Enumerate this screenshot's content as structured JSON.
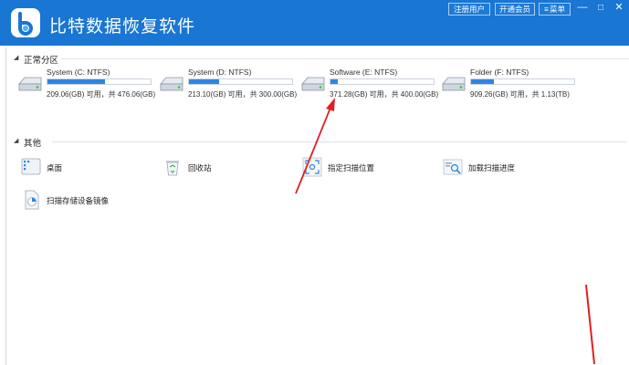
{
  "app": {
    "title": "比特数据恢复软件"
  },
  "header": {
    "register_label": "注册用户",
    "vip_label": "开通会员",
    "menu_label": "菜单",
    "minimize": "—",
    "maximize": "□",
    "close": "✕"
  },
  "sections": {
    "partitions_title": "正常分区",
    "other_title": "其他"
  },
  "drives": [
    {
      "name": "System (C: NTFS)",
      "capacity": "209.06(GB) 可用，共 476.06(GB)",
      "used_fraction": 0.56
    },
    {
      "name": "System (D: NTFS)",
      "capacity": "213.10(GB) 可用，共 300.00(GB)",
      "used_fraction": 0.29
    },
    {
      "name": "Software (E: NTFS)",
      "capacity": "371.28(GB) 可用，共 400.00(GB)",
      "used_fraction": 0.07
    },
    {
      "name": "Folder (F: NTFS)",
      "capacity": "909.26(GB) 可用，共 1.13(TB)",
      "used_fraction": 0.22
    }
  ],
  "tools": [
    {
      "label": "桌面",
      "icon": "desktop-icon"
    },
    {
      "label": "回收站",
      "icon": "recycle-bin-icon"
    },
    {
      "label": "指定扫描位置",
      "icon": "scan-location-icon"
    },
    {
      "label": "加载扫描进度",
      "icon": "load-scan-progress-icon"
    },
    {
      "label": "扫描存储设备镜像",
      "icon": "device-image-icon"
    }
  ],
  "colors": {
    "titlebar": "#1976d3",
    "bar_fill": "#2d86e2",
    "annotation_arrow": "#e02020"
  }
}
